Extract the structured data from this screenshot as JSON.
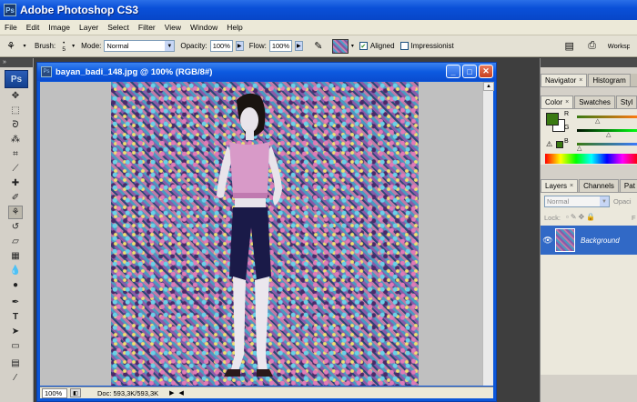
{
  "app": {
    "title": "Adobe Photoshop CS3",
    "logo_text": "Ps"
  },
  "menu": [
    "File",
    "Edit",
    "Image",
    "Layer",
    "Select",
    "Filter",
    "View",
    "Window",
    "Help"
  ],
  "options": {
    "brush_label": "Brush:",
    "brush_size": "5",
    "mode_label": "Mode:",
    "mode_value": "Normal",
    "opacity_label": "Opacity:",
    "opacity_value": "100%",
    "flow_label": "Flow:",
    "flow_value": "100%",
    "aligned_label": "Aligned",
    "aligned_checked": true,
    "impressionist_label": "Impressionist",
    "impressionist_checked": false,
    "workspace_label": "Worksp"
  },
  "document": {
    "title": "bayan_badi_148.jpg @ 100% (RGB/8#)",
    "zoom": "100%",
    "doc_info": "Doc: 593,3K/593,3K"
  },
  "panels": {
    "nav_tabs": [
      "Navigator",
      "Histogram"
    ],
    "color_tabs": [
      "Color",
      "Swatches",
      "Styl"
    ],
    "color_channels": [
      "R",
      "G",
      "B"
    ],
    "layers_tabs": [
      "Layers",
      "Channels",
      "Pat"
    ],
    "blend_mode": "Normal",
    "opacity_short": "Opaci",
    "lock_label": "Lock:",
    "fill_short": "F",
    "layer_name": "Background"
  },
  "colors": {
    "foreground": "#3a7a12",
    "title_blue": "#0a50d8",
    "layer_selected": "#3169c6"
  }
}
